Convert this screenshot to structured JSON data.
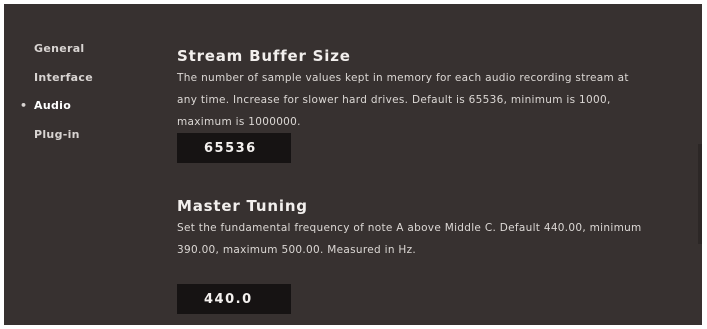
{
  "sidebar": {
    "items": [
      {
        "label": "General"
      },
      {
        "label": "Interface"
      },
      {
        "label": "Audio",
        "active": true
      },
      {
        "label": "Plug-in"
      }
    ],
    "active_marker": "•"
  },
  "settings": {
    "stream_buffer": {
      "title": "Stream Buffer Size",
      "description": "The number of sample values kept in memory for each audio recording stream at any time. Increase for slower hard drives. Default is 65536, minimum is 1000, maximum is 1000000.",
      "value": "65536"
    },
    "master_tuning": {
      "title": "Master Tuning",
      "description": "Set the fundamental frequency of note A above Middle C. Default 440.00, minimum 390.00, maximum 500.00. Measured in Hz.",
      "value": "440.0"
    }
  },
  "colors": {
    "background": "#373130",
    "field_background": "#161313",
    "text": "#dcd8d5"
  }
}
